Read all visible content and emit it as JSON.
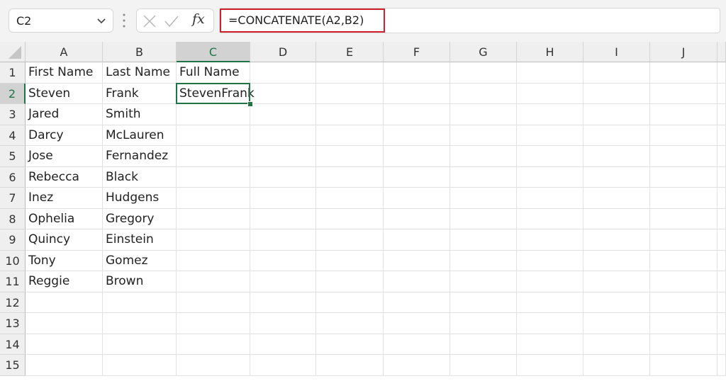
{
  "formula_bar": {
    "name_box": "C2",
    "formula": "=CONCATENATE(A2,B2)",
    "fx_label": "fx",
    "highlight_color": "#d0202a"
  },
  "sheet": {
    "columns": [
      "A",
      "B",
      "C",
      "D",
      "E",
      "F",
      "G",
      "H",
      "I",
      "J"
    ],
    "rows": [
      "1",
      "2",
      "3",
      "4",
      "5",
      "6",
      "7",
      "8",
      "9",
      "10",
      "11",
      "12",
      "13",
      "14",
      "15"
    ],
    "selected_cell": "C2",
    "accent_color": "#217346",
    "cells": [
      [
        "First Name",
        "Last Name",
        "Full Name"
      ],
      [
        "Steven",
        "Frank",
        "StevenFrank"
      ],
      [
        "Jared",
        "Smith",
        ""
      ],
      [
        "Darcy",
        "McLauren",
        ""
      ],
      [
        "Jose",
        "Fernandez",
        ""
      ],
      [
        "Rebecca",
        "Black",
        ""
      ],
      [
        "Inez",
        "Hudgens",
        ""
      ],
      [
        "Ophelia",
        "Gregory",
        ""
      ],
      [
        "Quincy",
        "Einstein",
        ""
      ],
      [
        "Tony",
        "Gomez",
        ""
      ],
      [
        "Reggie",
        "Brown",
        ""
      ],
      [
        "",
        "",
        ""
      ],
      [
        "",
        "",
        ""
      ],
      [
        "",
        "",
        ""
      ],
      [
        "",
        "",
        ""
      ]
    ]
  }
}
